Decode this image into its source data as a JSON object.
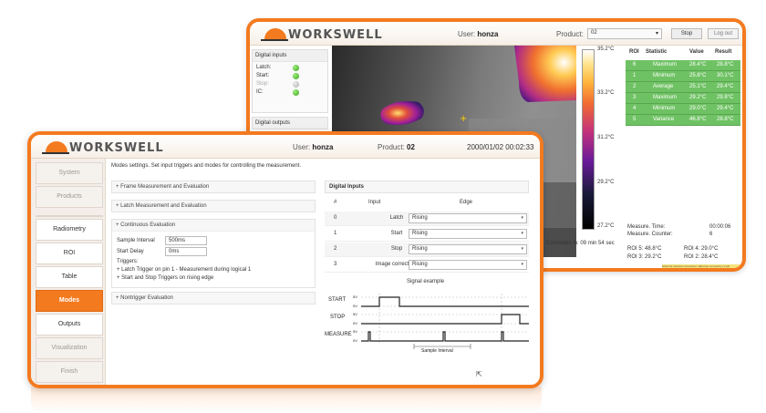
{
  "back_window": {
    "logo_text": "WORKSWELL",
    "user_label": "User:",
    "user_name": "honza",
    "product_label": "Product:",
    "product_value": "02",
    "stop_label": "Stop",
    "logout_label": "Log out",
    "digital_inputs_title": "Digital inputs",
    "inputs": [
      {
        "label": "Latch:",
        "state": "on"
      },
      {
        "label": "Start:",
        "state": "on"
      },
      {
        "label": "Stop:",
        "state": "off"
      },
      {
        "label": "IC:",
        "state": "on"
      }
    ],
    "digital_outputs_title": "Digital outputs",
    "scale_ticks": [
      "35.2°C",
      "33.2°C",
      "31.2°C",
      "29.2°C",
      "27.2°C"
    ],
    "correction_text": "Correction in: 09 min 54 sec",
    "roi_headers": [
      "ROI",
      "Statistic",
      "Value",
      "Result"
    ],
    "roi_rows": [
      {
        "roi": "6",
        "stat": "Maximum",
        "value": "28.4°C",
        "result": "28.8°C"
      },
      {
        "roi": "1",
        "stat": "Minimum",
        "value": "25.8°C",
        "result": "30.1°C"
      },
      {
        "roi": "2",
        "stat": "Average",
        "value": "25.1°C",
        "result": "29.4°C"
      },
      {
        "roi": "3",
        "stat": "Maximum",
        "value": "29.2°C",
        "result": "29.8°C"
      },
      {
        "roi": "4",
        "stat": "Minimum",
        "value": "29.0°C",
        "result": "29.4°C"
      },
      {
        "roi": "5",
        "stat": "Variance",
        "value": "46.8°C",
        "result": "28.8°C"
      }
    ],
    "measure_time_label": "Measure. Time:",
    "measure_time_value": "00:00:06",
    "measure_counter_label": "Measure. Counter:",
    "measure_counter_value": "6",
    "roi_summary": [
      "ROI 5: 48.8°C",
      "ROI 4: 29.0°C",
      "ROI 3: 29.2°C",
      "ROI 2: 28.4°C"
    ],
    "warning_text": "Ethernet network connection: Ethernet connection 1 will"
  },
  "front_window": {
    "logo_text": "WORKSWELL",
    "user_label": "User:",
    "user_name": "honza",
    "product_label": "Product:",
    "product_value": "02",
    "datetime": "2000/01/02 00:02:33",
    "nav": [
      {
        "label": "System",
        "state": "dim"
      },
      {
        "label": "Products",
        "state": "dim"
      },
      {
        "label": "Radiometry",
        "state": "normal"
      },
      {
        "label": "ROI",
        "state": "normal"
      },
      {
        "label": "Table",
        "state": "normal"
      },
      {
        "label": "Modes",
        "state": "active"
      },
      {
        "label": "Outputs",
        "state": "normal"
      },
      {
        "label": "Visualization",
        "state": "dim"
      },
      {
        "label": "Finish",
        "state": "dim"
      }
    ],
    "intro_text": "Modes settings. Set input triggers and modes for controlling the measurement.",
    "accordion": {
      "frame": "+ Frame Measurement and Evaluation",
      "latch": "+ Latch Measurement and Evaluation",
      "continuous": "+ Continuous Evaluation",
      "nontrigger": "+ Nontrigger Evaluation"
    },
    "continuous": {
      "sample_interval_label": "Sample Interval",
      "sample_interval_value": "500ms",
      "start_delay_label": "Start Delay",
      "start_delay_value": "0ms",
      "triggers_label": "Triggers:",
      "trigger_1": "+ Latch Trigger on pin 1 - Measurement during logical 1",
      "trigger_2": "+ Start and Stop Triggers on rising edge"
    },
    "digital_inputs_title": "Digital Inputs",
    "di_headers": [
      "#",
      "Input",
      "Edge"
    ],
    "di_rows": [
      {
        "n": "0",
        "input": "Latch",
        "edge": "Rising"
      },
      {
        "n": "1",
        "input": "Start",
        "edge": "Rising"
      },
      {
        "n": "2",
        "input": "Stop",
        "edge": "Rising"
      },
      {
        "n": "3",
        "input": "Image correction",
        "edge": "Rising"
      }
    ],
    "signal_title": "Signal example",
    "signal_labels": [
      "START",
      "STOP",
      "MEASURE"
    ],
    "signal_levels": [
      "5V",
      "0V",
      "5V",
      "0V",
      "5V",
      "0V"
    ],
    "sample_interval_caption": "Sample Interval"
  },
  "colors": {
    "accent": "#f47a1f",
    "roi_green": "#6fc264"
  }
}
